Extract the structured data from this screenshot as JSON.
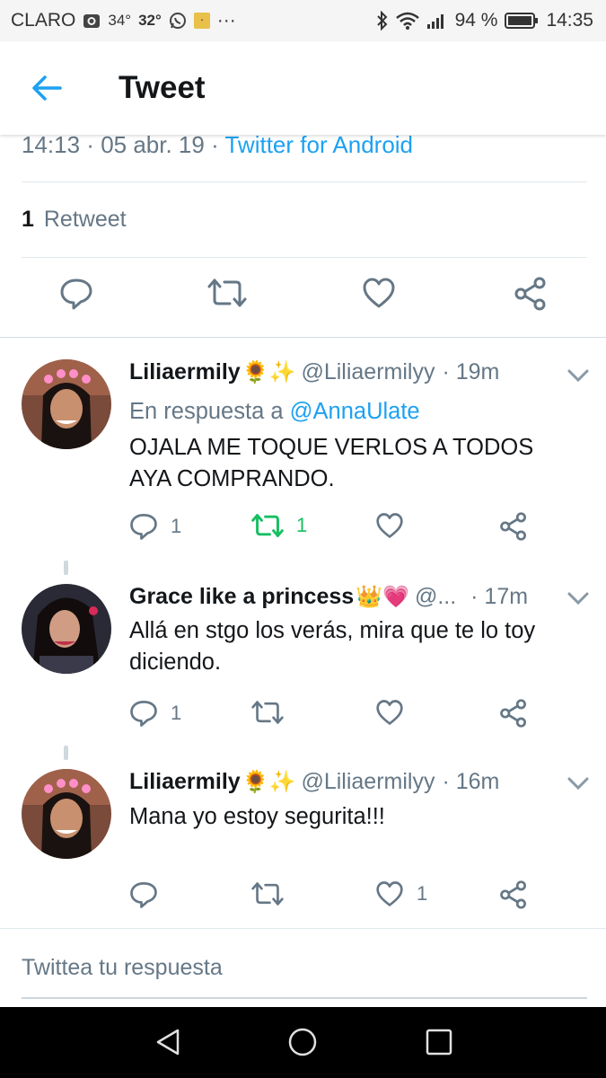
{
  "status_bar": {
    "carrier": "CLARO",
    "temp1": "34°",
    "temp2": "32°",
    "dots": "···",
    "battery": "94 %",
    "time": "14:35"
  },
  "header": {
    "title": "Tweet"
  },
  "tweet": {
    "time": "14:13",
    "sep": " · ",
    "date": "05 abr. 19",
    "source": "Twitter for Android",
    "retweets_count": "1",
    "retweets_label": "Retweet"
  },
  "replies": [
    {
      "name": "Liliaermily",
      "emoji": "🌻✨",
      "handle": "@Liliaermilyy",
      "time": "· 19m",
      "in_reply_prefix": "En respuesta a ",
      "in_reply_to": "@AnnaUlate",
      "text": "OJALA ME TOQUE VERLOS A TODOS AYA COMPRANDO.",
      "reply_count": "1",
      "retweet_count": "1",
      "like_count": ""
    },
    {
      "name": "Grace like a princess",
      "emoji": "👑💗",
      "handle": "@...",
      "time": "· 17m",
      "text": "Allá en stgo los verás, mira que te lo toy diciendo.",
      "reply_count": "1",
      "retweet_count": "",
      "like_count": ""
    },
    {
      "name": "Liliaermily",
      "emoji": "🌻✨",
      "handle": "@Liliaermilyy",
      "time": "· 16m",
      "text": "Mana yo estoy segurita!!!",
      "reply_count": "",
      "retweet_count": "",
      "like_count": "1"
    }
  ],
  "compose": {
    "placeholder": "Twittea tu respuesta"
  },
  "colors": {
    "accent": "#1da1f2",
    "retweet_active": "#17bf63",
    "muted": "#657786"
  }
}
